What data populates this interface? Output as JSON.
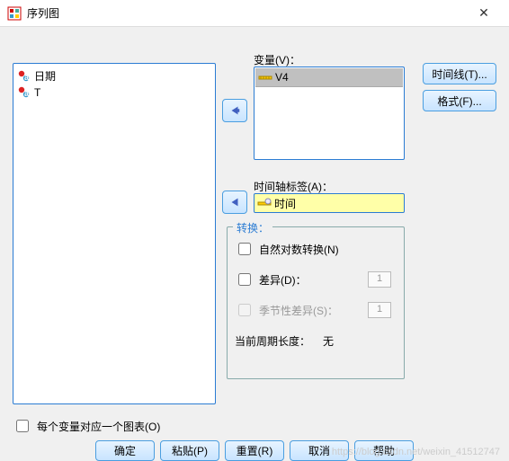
{
  "window": {
    "title": "序列图"
  },
  "source_list": [
    {
      "icon": "nominal-icon",
      "label": "日期"
    },
    {
      "icon": "nominal-icon",
      "label": "T"
    }
  ],
  "variables": {
    "label": "变量(V)：",
    "items": [
      {
        "icon": "scale-icon",
        "label": "V4"
      }
    ]
  },
  "time_axis": {
    "label": "时间轴标签(A)：",
    "icon": "scale-icon",
    "value": "时间"
  },
  "transform": {
    "legend": "转换：",
    "log": {
      "label": "自然对数转换(N)",
      "checked": false
    },
    "diff": {
      "label": "差异(D)：",
      "checked": false,
      "value": "1"
    },
    "seasonal": {
      "label": "季节性差异(S)：",
      "checked": false,
      "enabled": false,
      "value": "1"
    },
    "period": {
      "label": "当前周期长度：",
      "value": "无"
    }
  },
  "side_buttons": {
    "timeline": "时间线(T)...",
    "format": "格式(F)..."
  },
  "each_var_chart": {
    "label": "每个变量对应一个图表(O)",
    "checked": false
  },
  "dialog_buttons": {
    "ok": "确定",
    "paste": "粘贴(P)",
    "reset": "重置(R)",
    "cancel": "取消",
    "help": "帮助"
  },
  "watermark": "https://blog.csdn.net/weixin_41512747"
}
